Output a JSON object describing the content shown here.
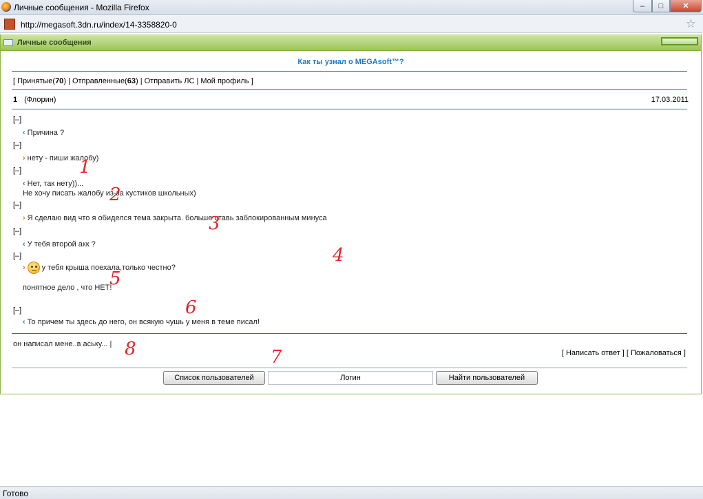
{
  "window": {
    "title": "Личные сообщения - Mozilla Firefox",
    "min": "–",
    "max": "□",
    "close": "✕"
  },
  "address": {
    "url": "http://megasoft.3dn.ru/index/14-3358820-0",
    "star": "☆"
  },
  "panel": {
    "title": "Личные сообщения"
  },
  "topic": "Как ты узнал о MEGAsoft™?",
  "nav": {
    "open": "[",
    "inbox_label": "Принятые(",
    "inbox_count": "70",
    "inbox_close": ")",
    "sep1": " | ",
    "sent_label": "Отправленные(",
    "sent_count": "63",
    "sent_close": ")",
    "sep2": " | ",
    "send": "Отправить ЛС",
    "sep3": " | ",
    "profile": "Мой профиль",
    "close": " ]"
  },
  "message": {
    "number": "1",
    "author": "(Флорин)",
    "date": "17.03.2011"
  },
  "thread": [
    {
      "toggle": "[–]",
      "dir": "in",
      "text": "Причина ?",
      "mark": "1"
    },
    {
      "toggle": "[–]",
      "dir": "out",
      "text": "нету - пиши жалобу)",
      "mark": "2"
    },
    {
      "toggle": "[–]",
      "dir": "in",
      "text": "Нет, так нету))...",
      "text2": "Не хочу писать жалобу из-за кустиков школьных)",
      "mark": "3"
    },
    {
      "toggle": "[–]",
      "dir": "out",
      "text": "Я сделаю вид что я обиделся тема закрыта. больше ставь заблокированным минуса",
      "mark": "4"
    },
    {
      "toggle": "[–]",
      "dir": "in",
      "text": "У тебя второй акк ?",
      "mark": "5"
    },
    {
      "toggle": "[–]",
      "dir": "out",
      "text": "у тебя крыша поехала,только честно?",
      "text2": "понятное дело , что НЕТ!",
      "mark": "6"
    },
    {
      "toggle": "[–]",
      "dir": "in",
      "text": "То причем ты здесь до него, он всякую чушь у меня в теме писал!",
      "mark": "7"
    }
  ],
  "reply": {
    "text": "он написал мене..в аську...",
    "cursor": "|",
    "mark": "8"
  },
  "actions": {
    "reply": "[ Написать ответ ]",
    "report": "[ Пожаловаться ]"
  },
  "bottom": {
    "users_button": "Список пользователей",
    "login_value": "Логин",
    "find_button": "Найти пользователей"
  },
  "status": "Готово",
  "arrows": {
    "in": "‹",
    "out": "›"
  }
}
